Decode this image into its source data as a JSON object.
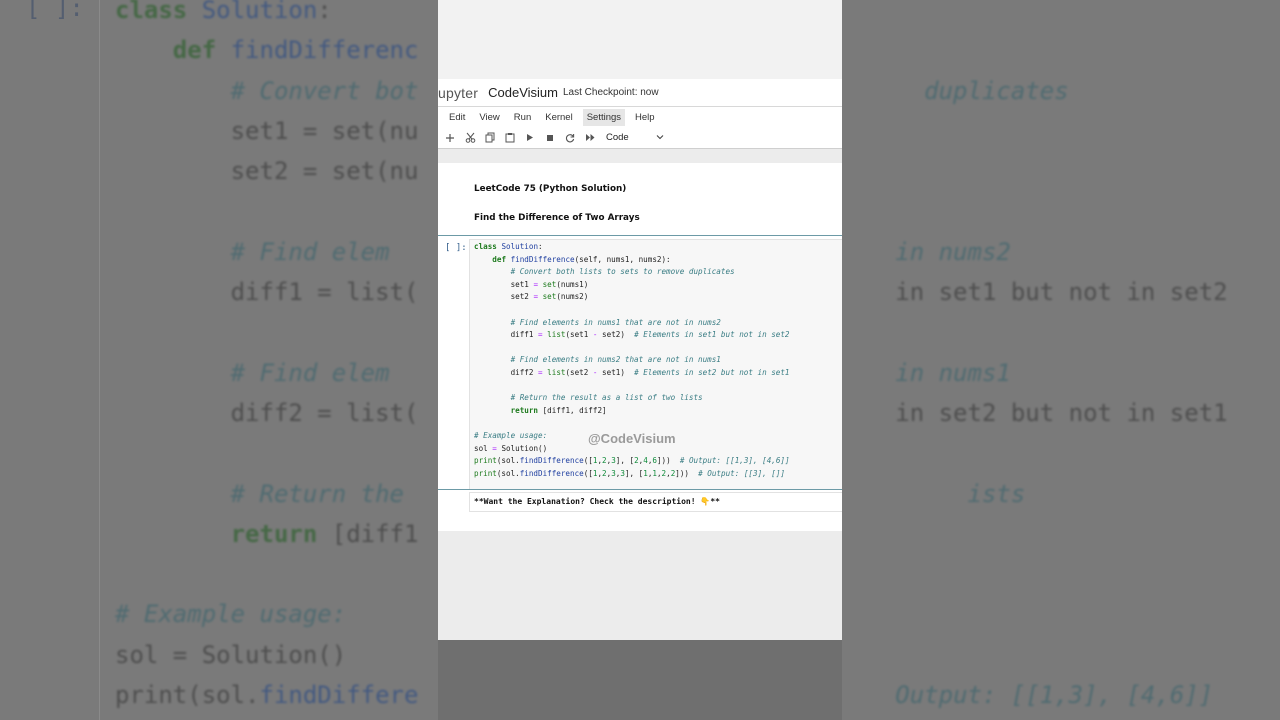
{
  "notebook": {
    "logo": "upyter",
    "title": "CodeVisium",
    "checkpoint": "Last Checkpoint: now"
  },
  "menu": [
    "Edit",
    "View",
    "Run",
    "Kernel",
    "Settings",
    "Help"
  ],
  "toolbar": {
    "icons": [
      "plus-icon",
      "cut-icon",
      "copy-icon",
      "paste-icon",
      "run-icon",
      "stop-icon",
      "restart-icon",
      "run-all-icon"
    ],
    "cell_type": "Code"
  },
  "markdown": {
    "heading": "LeetCode 75 (Python Solution)",
    "subheading": "Find the Difference of Two Arrays"
  },
  "cell": {
    "prompt": "[ ]:",
    "lines": [
      "class Solution:",
      "    def findDifference(self, nums1, nums2):",
      "        # Convert both lists to sets to remove duplicates",
      "        set1 = set(nums1)",
      "        set2 = set(nums2)",
      "",
      "        # Find elements in nums1 that are not in nums2",
      "        diff1 = list(set1 - set2)  # Elements in set1 but not in set2",
      "",
      "        # Find elements in nums2 that are not in nums1",
      "        diff2 = list(set2 - set1)  # Elements in set2 but not in set1",
      "",
      "        # Return the result as a list of two lists",
      "        return [diff1, diff2]",
      "",
      "# Example usage:",
      "sol = Solution()",
      "print(sol.findDifference([1,2,3], [2,4,6]))  # Output: [[1,3], [4,6]]",
      "print(sol.findDifference([1,2,3,3], [1,1,2,2]))  # Output: [[3], []]"
    ]
  },
  "watermark": "@CodeVisium",
  "explanation": "**Want the Explanation? Check the description! 👇**"
}
